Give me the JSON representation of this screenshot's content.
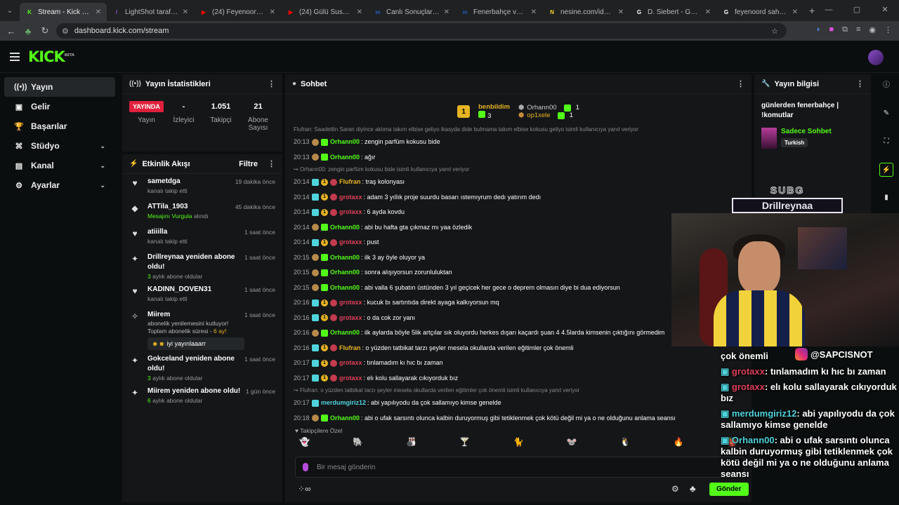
{
  "browser": {
    "tabs": [
      {
        "title": "Stream - Kick Dashbo",
        "icon_color": "#53fc18",
        "icon_glyph": "K",
        "active": true
      },
      {
        "title": "LightShot tarafından",
        "icon_color": "#9b59d6",
        "icon_glyph": "/",
        "active": false
      },
      {
        "title": "(24) Feyenoord - Fen",
        "icon_color": "#ff0000",
        "icon_glyph": "▶",
        "active": false
      },
      {
        "title": "(24) Gülü Susuz Seni",
        "icon_color": "#ff0000",
        "icon_glyph": "▶",
        "active": false
      },
      {
        "title": "Canlı Sonuçlar - İdda",
        "icon_color": "#1e5fb8",
        "icon_glyph": "m",
        "active": false
      },
      {
        "title": "Fenerbahçe vs Benfic",
        "icon_color": "#1e5fb8",
        "icon_glyph": "m",
        "active": false
      },
      {
        "title": "nesine.com/iddaa?et",
        "icon_color": "#f5d327",
        "icon_glyph": "N",
        "active": false
      },
      {
        "title": "D. Siebert - Google'd",
        "icon_color": "#ffffff",
        "icon_glyph": "G",
        "active": false
      },
      {
        "title": "feyenoord saha - Goo",
        "icon_color": "#ffffff",
        "icon_glyph": "G",
        "active": false
      }
    ],
    "url": "dashboard.kick.com/stream"
  },
  "sidebar": {
    "items": [
      {
        "label": "Yayın",
        "icon": "broadcast-icon",
        "active": true,
        "expandable": false
      },
      {
        "label": "Gelir",
        "icon": "wallet-icon",
        "active": false,
        "expandable": false
      },
      {
        "label": "Başarılar",
        "icon": "trophy-icon",
        "active": false,
        "expandable": false
      },
      {
        "label": "Stüdyo",
        "icon": "studio-icon",
        "active": false,
        "expandable": true
      },
      {
        "label": "Kanal",
        "icon": "channel-icon",
        "active": false,
        "expandable": true
      },
      {
        "label": "Ayarlar",
        "icon": "gear-icon",
        "active": false,
        "expandable": true
      }
    ]
  },
  "stats": {
    "title": "Yayın İstatistikleri",
    "items": [
      {
        "value": "YAYINDA",
        "label": "Yayın"
      },
      {
        "value": "-",
        "label": "İzleyici"
      },
      {
        "value": "1.051",
        "label": "Takipçi"
      },
      {
        "value": "21",
        "label": "Abone Sayısı"
      }
    ]
  },
  "activity": {
    "title": "Etkinlik Akışı",
    "filter_label": "Filtre",
    "items": [
      {
        "icon": "heart-icon",
        "glyph": "♥",
        "name": "sametdga",
        "sub": "kanalı takip etti",
        "sub_hl": "",
        "time": "19 dakika önce"
      },
      {
        "icon": "shapes-icon",
        "glyph": "◆",
        "name": "ATTila_1903",
        "sub": "alındı",
        "sub_hl": "Mesajını Vurgula",
        "time": "45 dakika önce"
      },
      {
        "icon": "heart-icon",
        "glyph": "♥",
        "name": "atiiilla",
        "sub": "kanalı takip etti",
        "sub_hl": "",
        "time": "1 saat önce"
      },
      {
        "icon": "sparkle-icon",
        "glyph": "✦",
        "name": "Drillreynaa yeniden abone oldu!",
        "sub": "aylık abone oldular",
        "sub_hl": "3",
        "time": "1 saat önce"
      },
      {
        "icon": "heart-icon",
        "glyph": "♥",
        "name": "KADINN_DOVEN31",
        "sub": "kanalı takip etti",
        "sub_hl": "",
        "time": "1 saat önce"
      }
    ],
    "special": {
      "icon": "sparkle-icon",
      "name": "Miirem",
      "time": "1 saat önce",
      "text": "abonelik yenilemesini kutluyor! Toplam abonelik süresi -",
      "text_hl": "6 ay!",
      "message": "iyi yayınlaaarr"
    },
    "items2": [
      {
        "icon": "sparkle-icon",
        "glyph": "✦",
        "name": "Gokceland yeniden abone oldu!",
        "sub": "aylık abone oldular",
        "sub_hl": "3",
        "time": "1 saat önce"
      },
      {
        "icon": "sparkle-icon",
        "glyph": "✦",
        "name": "Miirem yeniden abone oldu!",
        "sub": "aylık abone oldular",
        "sub_hl": "6",
        "time": "1 gün önce"
      }
    ]
  },
  "chat": {
    "title": "Sohbet",
    "pinned": {
      "rank_badge": "1",
      "gifter": "benbildim",
      "gifter_count": "3",
      "others": [
        {
          "name": "Orhann00",
          "count": "1"
        },
        {
          "name": "op1xele",
          "count": "1"
        }
      ]
    },
    "top_reply": "Flufran: Saadettin Saran diyince aklıma takım elbise geliyo ikasyda dide bulmama takım elbise kokusu geliyo isimli kullanıcıya yanıt veriyor",
    "messages": [
      {
        "time": "20:13",
        "badges": [
          "b",
          "g"
        ],
        "user": "Orhann00",
        "color": "#53fc18",
        "text": ": zengin parfüm kokusu bide"
      },
      {
        "time": "20:13",
        "badges": [
          "b",
          "g"
        ],
        "user": "Orhann00",
        "color": "#53fc18",
        "text": ": ağır"
      },
      {
        "reply": "Orhann00: zengin parfüm kokusu bide isimli kullanıcıya yanıt veriyor"
      },
      {
        "time": "20:14",
        "badges": [
          "c",
          "o",
          "r"
        ],
        "user": "Flufran",
        "color": "#e6b422",
        "text": ": traş kolonyası"
      },
      {
        "time": "20:14",
        "badges": [
          "c",
          "o",
          "r"
        ],
        "user": "grotaxx",
        "color": "#e0405a",
        "text": ": adam 3 yıllık proje suurdu basarı ıstemıyrum dedı yatırım dedı"
      },
      {
        "time": "20:14",
        "badges": [
          "c",
          "o",
          "r"
        ],
        "user": "grotaxx",
        "color": "#e0405a",
        "text": ": 6 ayda kovdu"
      },
      {
        "time": "20:14",
        "badges": [
          "b",
          "g"
        ],
        "user": "Orhann00",
        "color": "#53fc18",
        "text": ": abi bu hafta gta çıkmaz mı yaa özledik"
      },
      {
        "time": "20:14",
        "badges": [
          "c",
          "o",
          "r"
        ],
        "user": "grotaxx",
        "color": "#e0405a",
        "text": ": pust"
      },
      {
        "time": "20:15",
        "badges": [
          "b",
          "g"
        ],
        "user": "Orhann00",
        "color": "#53fc18",
        "text": ": ilk 3 ay öyle oluyor ya"
      },
      {
        "time": "20:15",
        "badges": [
          "b",
          "g"
        ],
        "user": "Orhann00",
        "color": "#53fc18",
        "text": ": sonra alışıyorsun zorunluluktan"
      },
      {
        "time": "20:15",
        "badges": [
          "b",
          "g"
        ],
        "user": "Orhann00",
        "color": "#53fc18",
        "text": ": abi valla 6 şubatın üstünden 3 yıl geçicek her gece o deprem olmasın diye bi dua ediyorsun"
      },
      {
        "time": "20:16",
        "badges": [
          "c",
          "o",
          "r"
        ],
        "user": "grotaxx",
        "color": "#e0405a",
        "text": ": kucuk bı sartıntıda direkt ayaga kalkıyorsun mq"
      },
      {
        "time": "20:16",
        "badges": [
          "c",
          "o",
          "r"
        ],
        "user": "grotaxx",
        "color": "#e0405a",
        "text": ": o da cok zor yanı"
      },
      {
        "time": "20:16",
        "badges": [
          "b",
          "g"
        ],
        "user": "Orhann00",
        "color": "#53fc18",
        "text": ": ilk aylarda böyle 5lik artçılar sık oluyordu herkes dışarı kaçardı şuan 4 4.5larda kimsenin çıktığını görmedim"
      },
      {
        "time": "20:16",
        "badges": [
          "c",
          "o",
          "r"
        ],
        "user": "Flufran",
        "color": "#e6b422",
        "text": ": o yüzden tatbikat tarzı şeyler mesela okullarda verilen eğitimler çok önemli"
      },
      {
        "time": "20:17",
        "badges": [
          "c",
          "o",
          "r"
        ],
        "user": "grotaxx",
        "color": "#e0405a",
        "text": ": tınlamadım kı hıc bı zaman"
      },
      {
        "time": "20:17",
        "badges": [
          "c",
          "o",
          "r"
        ],
        "user": "grotaxx",
        "color": "#e0405a",
        "text": ": elı kolu sallayarak cıkıyorduk bız"
      },
      {
        "reply": "Flufran: o yüzden tatbikat tarzı şeyler mesela okullarda verilen eğitimler çok önemli isimli kullanıcıya yanıt veriyor"
      },
      {
        "time": "20:17",
        "badges": [
          "c"
        ],
        "user": "merdumgiriz12",
        "color": "#4fd3dc",
        "text": ": abi yapılıyodu da çok sallamıyo kimse genelde"
      },
      {
        "time": "20:18",
        "badges": [
          "b",
          "g"
        ],
        "user": "Orhann00",
        "color": "#53fc18",
        "text": ": abi o ufak sarsıntı olunca kalbin duruyormuş gibi tetiklenmek çok kötü değil mi ya o ne olduğunu anlama seansı"
      }
    ],
    "emotes_label": "Takipçilere Özel",
    "emotes": [
      "👻",
      "🐘",
      "🎳",
      "🍸",
      "🐈",
      "🐭",
      "🐧",
      "🔥",
      "👹"
    ],
    "input_placeholder": "Bir mesaj gönderin",
    "send_label": "Gönder"
  },
  "stream_info": {
    "title": "Yayın bilgisi",
    "stream_title": "günlerden fenerbahçe | !komutlar",
    "category": "Sadece Sohbet",
    "language": "Turkish"
  },
  "overlay": {
    "subg_title": "SUBG",
    "subg_name": "Drillreynaa",
    "instagram": "@SAPCISNOT",
    "overlay_chat": [
      {
        "user": "",
        "text": "çok önemli"
      },
      {
        "user": "grotaxx",
        "text": ": tınlamadım kı hıc bı zaman"
      },
      {
        "user": "grotaxx",
        "text": ": elı kolu sallayarak cıkıyorduk bız"
      },
      {
        "user": "merdumgiriz12",
        "text": ": abi yapılıyodu da çok sallamıyo kimse genelde"
      },
      {
        "user": "Orhann00",
        "text": ": abi o ufak sarsıntı olunca kalbin duruyormuş gibi tetiklenmek çok kötü değil mi ya o ne olduğunu anlama seansı"
      }
    ]
  }
}
